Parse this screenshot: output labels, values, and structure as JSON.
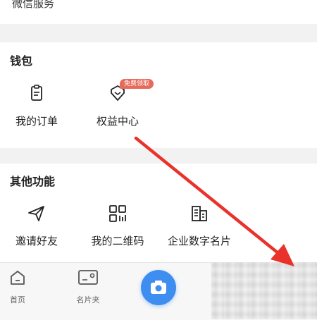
{
  "top_section": {
    "item_label": "微信服务"
  },
  "wallet": {
    "title": "钱包",
    "items": [
      {
        "label": "我的订单",
        "icon": "order-icon"
      },
      {
        "label": "权益中心",
        "icon": "benefits-icon",
        "badge": "免费领取"
      }
    ]
  },
  "other": {
    "title": "其他功能",
    "items": [
      {
        "label": "邀请好友",
        "icon": "send-icon"
      },
      {
        "label": "我的二维码",
        "icon": "qr-code-icon"
      },
      {
        "label": "企业数字名片",
        "icon": "building-icon"
      }
    ]
  },
  "bottom_nav": {
    "tabs": [
      {
        "label": "首页",
        "icon": "home-icon"
      },
      {
        "label": "名片夹",
        "icon": "card-holder-icon"
      },
      {
        "label": "",
        "icon": "camera-icon"
      }
    ]
  },
  "colors": {
    "accent": "#3d8ef0",
    "badge": "#e86a5b",
    "arrow": "#e8322a"
  }
}
